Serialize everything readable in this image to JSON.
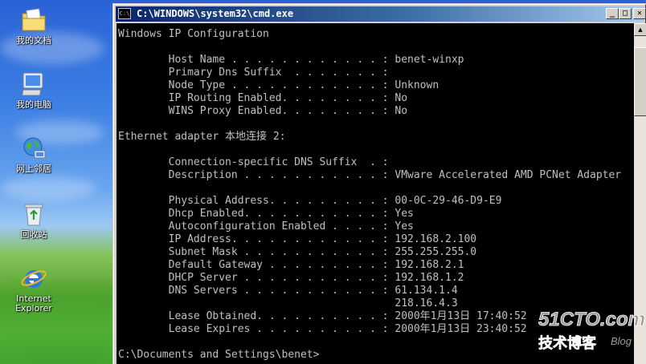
{
  "desktop": {
    "icons": [
      {
        "label": "我的文档",
        "icon": "my-documents-icon"
      },
      {
        "label": "我的电脑",
        "icon": "my-computer-icon"
      },
      {
        "label": "网上邻居",
        "icon": "network-places-icon"
      },
      {
        "label": "回收站",
        "icon": "recycle-bin-icon"
      },
      {
        "label": "Internet\nExplorer",
        "icon": "internet-explorer-icon"
      }
    ]
  },
  "window": {
    "title": "C:\\WINDOWS\\system32\\cmd.exe",
    "system_icon_text": "C:\\",
    "minimize_glyph": "_",
    "maximize_glyph": "□",
    "close_glyph": "✕"
  },
  "console": {
    "lines": [
      "Windows IP Configuration",
      "",
      "        Host Name . . . . . . . . . . . . : benet-winxp",
      "        Primary Dns Suffix  . . . . . . . :",
      "        Node Type . . . . . . . . . . . . : Unknown",
      "        IP Routing Enabled. . . . . . . . : No",
      "        WINS Proxy Enabled. . . . . . . . : No",
      "",
      "Ethernet adapter 本地连接 2:",
      "",
      "        Connection-specific DNS Suffix  . :",
      "        Description . . . . . . . . . . . : VMware Accelerated AMD PCNet Adapter",
      "",
      "        Physical Address. . . . . . . . . : 00-0C-29-46-D9-E9",
      "        Dhcp Enabled. . . . . . . . . . . : Yes",
      "        Autoconfiguration Enabled . . . . : Yes",
      "        IP Address. . . . . . . . . . . . : 192.168.2.100",
      "        Subnet Mask . . . . . . . . . . . : 255.255.255.0",
      "        Default Gateway . . . . . . . . . : 192.168.2.1",
      "        DHCP Server . . . . . . . . . . . : 192.168.1.2",
      "        DNS Servers . . . . . . . . . . . : 61.134.1.4",
      "                                            218.16.4.3",
      "        Lease Obtained. . . . . . . . . . : 2000年1月13日 17:40:52",
      "        Lease Expires . . . . . . . . . . : 2000年1月13日 23:40:52",
      "",
      "C:\\Documents and Settings\\benet>"
    ]
  },
  "watermark": {
    "brand": "51CTO.com",
    "subtitle": "技术博客",
    "tag": "Blog"
  },
  "colors": {
    "console_text": "#c0c0c0",
    "console_bg": "#000000",
    "titlebar_start": "#0a246a",
    "titlebar_end": "#a6caf0"
  }
}
